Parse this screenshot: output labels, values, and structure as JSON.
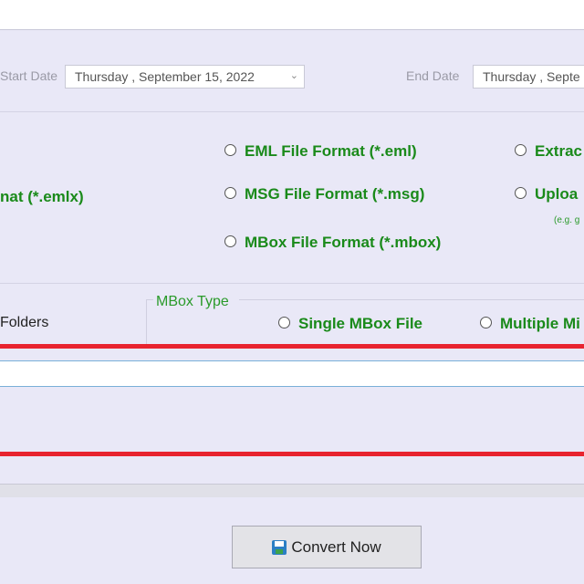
{
  "date_filter": {
    "start_label": "Start Date",
    "start_value": "Thursday  , September 15, 2022",
    "end_label": "End Date",
    "end_value": "Thursday  , Septe"
  },
  "formats": {
    "emlx": "nat (*.emlx)",
    "eml": "EML File  Format (*.eml)",
    "msg": "MSG File Format (*.msg)",
    "mbox": "MBox File Format (*.mbox)",
    "extract": "Extrac",
    "upload": "Uploa",
    "upload_hint": "(e.g. g"
  },
  "folders": {
    "label": "Folders"
  },
  "mbox_type": {
    "title": "MBox Type",
    "single": "Single MBox File",
    "multiple": "Multiple Mi"
  },
  "actions": {
    "convert_label": "Convert Now"
  },
  "colors": {
    "option_text": "#1a8a1a",
    "highlight": "#e8232f",
    "background": "#e9e8f7"
  }
}
